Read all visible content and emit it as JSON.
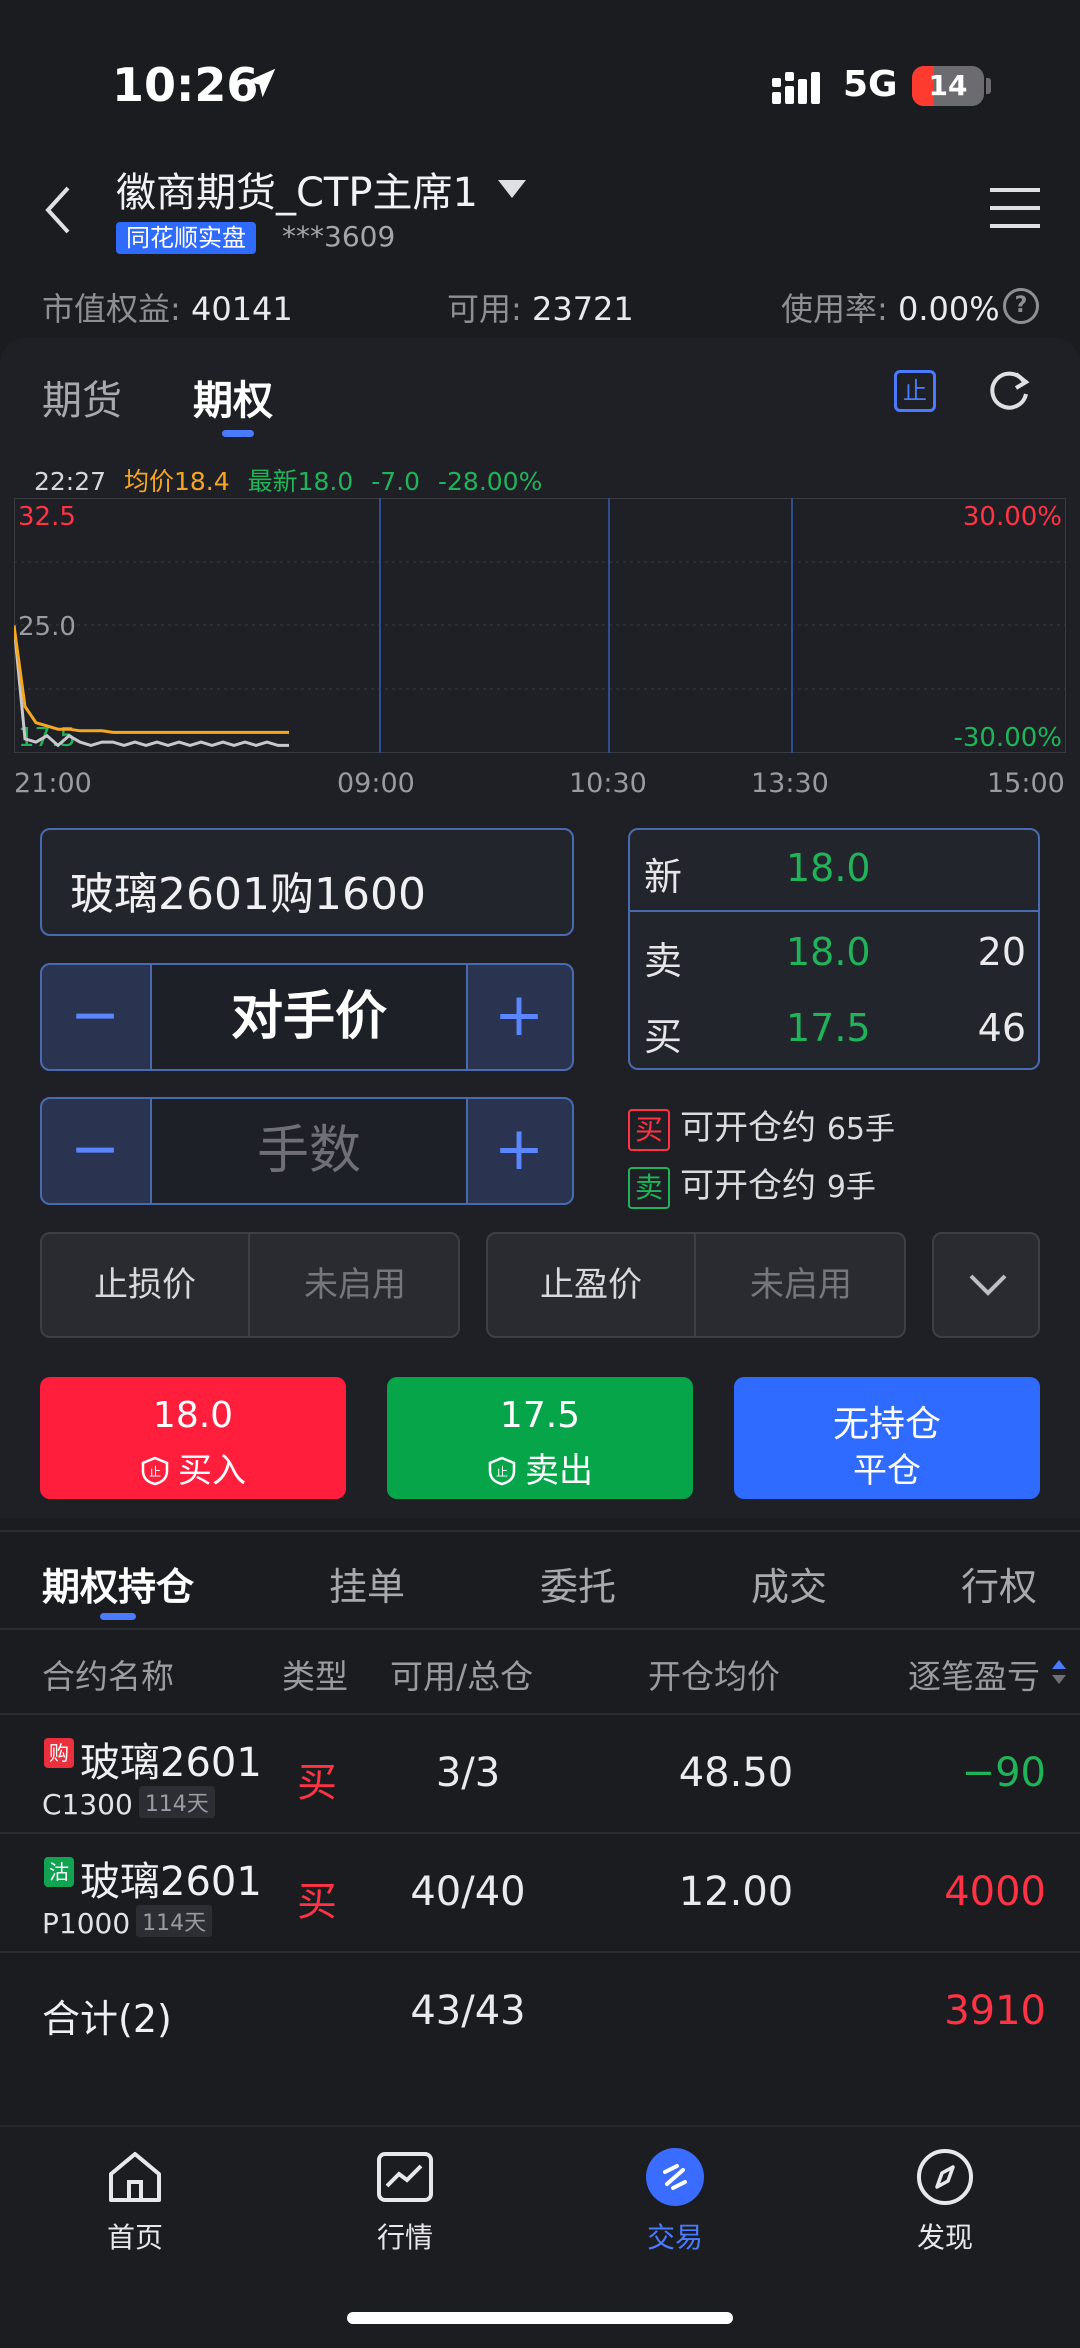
{
  "status_bar": {
    "time": "10:26",
    "network": "5G",
    "battery": "14"
  },
  "header": {
    "account_title": "徽商期货_CTP主席1",
    "account_tag": "同花顺实盘",
    "account_number": "***3609"
  },
  "metrics": {
    "equity_label": "市值权益:",
    "equity_value": "40141",
    "available_label": "可用:",
    "available_value": "23721",
    "usage_label": "使用率:",
    "usage_value": "0.00%",
    "help_icon": "?"
  },
  "tabs": {
    "futures": "期货",
    "options": "期权",
    "stop_icon_text": "止"
  },
  "chart_header": {
    "time": "22:27",
    "avg_label": "均价18.4",
    "latest_label": "最新18.0",
    "change": "-7.0",
    "change_pct": "-28.00%"
  },
  "chart_data": {
    "type": "line",
    "y_max_label": "32.5",
    "y_mid_label": "25.0",
    "y_min_label": "17.5",
    "pct_max_label": "30.00%",
    "pct_min_label": "-30.00%",
    "x_ticks": [
      "21:00",
      "09:00",
      "10:30",
      "13:30",
      "15:00"
    ],
    "ylim": [
      17.5,
      32.5
    ],
    "series": [
      {
        "color": "#c8c8cc",
        "values": [
          25.0,
          18.0,
          17.8,
          18.2,
          17.6,
          18.2,
          17.8,
          17.6,
          17.8,
          17.8,
          17.6,
          17.8,
          17.6,
          17.8,
          17.6,
          17.8,
          17.6,
          17.8,
          17.6,
          17.8,
          17.6,
          17.8,
          17.6,
          17.8,
          17.6,
          17.6
        ]
      },
      {
        "color": "#f5a623",
        "values": [
          25.0,
          20.0,
          19.0,
          18.8,
          18.6,
          18.6,
          18.5,
          18.5,
          18.5,
          18.4,
          18.4,
          18.4,
          18.4,
          18.4,
          18.4,
          18.4,
          18.4,
          18.4,
          18.4,
          18.4,
          18.4,
          18.4,
          18.4,
          18.4,
          18.4,
          18.4
        ]
      }
    ]
  },
  "order": {
    "contract": "玻璃2601购1600",
    "price_mode": "对手价",
    "qty_placeholder": "手数",
    "minus": "−",
    "plus": "+"
  },
  "quote": {
    "new_label": "新",
    "new_price": "18.0",
    "sell_label": "卖",
    "sell_price": "18.0",
    "sell_vol": "20",
    "buy_label": "买",
    "buy_price": "17.5",
    "buy_vol": "46"
  },
  "available": {
    "buy_tag": "买",
    "buy_text": "可开仓约",
    "buy_qty": "65手",
    "sell_tag": "卖",
    "sell_text": "可开仓约",
    "sell_qty": "9手"
  },
  "stops": {
    "stop_loss": "止损价",
    "stop_loss_state": "未启用",
    "take_profit": "止盈价",
    "take_profit_state": "未启用"
  },
  "actions": {
    "buy_price": "18.0",
    "buy_label": "买入",
    "sell_price": "17.5",
    "sell_label": "卖出",
    "close_primary": "无持仓",
    "close_label": "平仓",
    "buy_color": "#ff1f3d",
    "sell_color": "#07a54a",
    "close_color": "#2f6bff"
  },
  "position_tabs": [
    "期权持仓",
    "挂单",
    "委托",
    "成交",
    "行权"
  ],
  "table": {
    "headers": [
      "合约名称",
      "类型",
      "可用/总仓",
      "开仓均价",
      "逐笔盈亏"
    ],
    "rows": [
      {
        "badge": "购",
        "name": "玻璃2601",
        "code": "C1300",
        "days": "114天",
        "type": "买",
        "qty": "3/3",
        "avg": "48.50",
        "pnl": "−90"
      },
      {
        "badge": "沽",
        "name": "玻璃2601",
        "code": "P1000",
        "days": "114天",
        "type": "买",
        "qty": "40/40",
        "avg": "12.00",
        "pnl": "4000"
      }
    ],
    "total_label": "合计(2)",
    "total_qty": "43/43",
    "total_pnl": "3910"
  },
  "bottom_nav": [
    "首页",
    "行情",
    "交易",
    "发现"
  ]
}
